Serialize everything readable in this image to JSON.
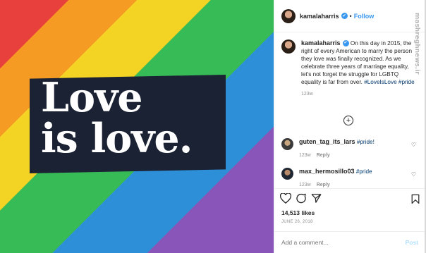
{
  "image": {
    "slogan": "Love\nis love.",
    "stripe_colors": [
      "#e8413d",
      "#f59a23",
      "#f3d425",
      "#37bb57",
      "#2e8fd9",
      "#8a55b8"
    ],
    "band_color": "#1b2233"
  },
  "header": {
    "username": "kamalaharris",
    "separator": "•",
    "follow_label": "Follow"
  },
  "caption": {
    "username": "kamalaharris",
    "text": "On this day in 2015, the right of every American to marry the person they love was finally recognized. As we celebrate three years of marriage equality, let's not forget the struggle for LGBTQ equality is far from over.",
    "hashtags": "#LoveIsLove #pride",
    "time": "123w"
  },
  "comments": [
    {
      "username": "guten_tag_its_lars",
      "text": "#pride!",
      "time": "123w",
      "reply_label": "Reply"
    },
    {
      "username": "max_hermosillo03",
      "text": "#pride",
      "time": "123w",
      "reply_label": "Reply"
    }
  ],
  "icons": {
    "verified": "verified-badge-icon",
    "heart": "heart-icon",
    "comment": "comment-icon",
    "share": "share-icon",
    "save": "bookmark-icon",
    "more": "plus-circle-icon"
  },
  "likes": "14,513 likes",
  "date": "JUNE 26, 2018",
  "comment_box": {
    "placeholder": "Add a comment...",
    "post_label": "Post"
  },
  "watermark": "mashreghnews.ir",
  "colors": {
    "accent": "#3897f0",
    "hashtag": "#00376b",
    "post_disabled": "#b2dffc"
  }
}
